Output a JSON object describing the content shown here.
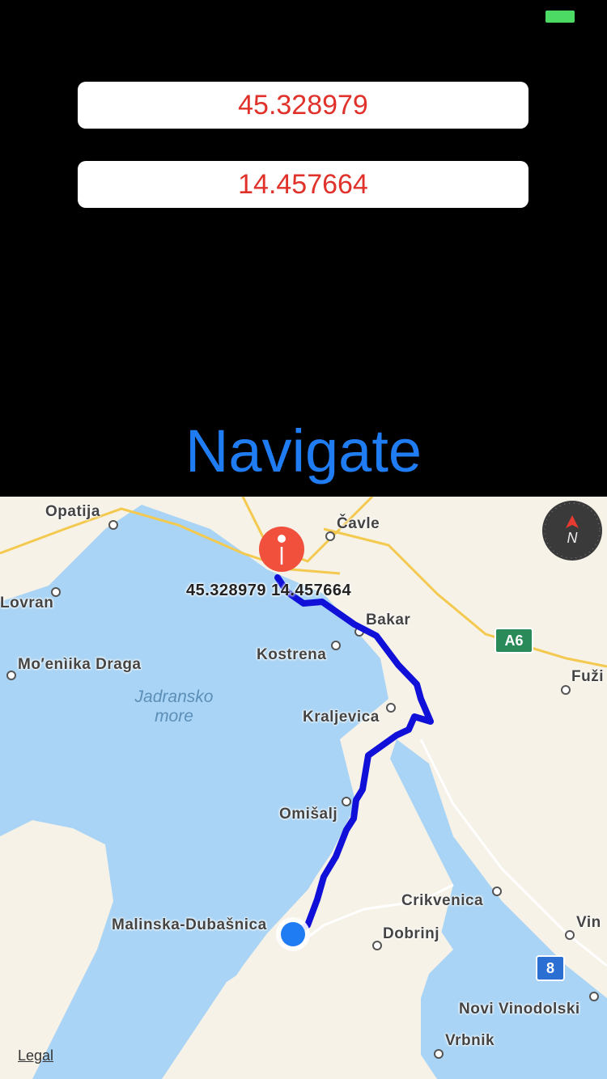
{
  "inputs": {
    "latitude": "45.328979",
    "longitude": "14.457664"
  },
  "navigate_label": "Navigate",
  "colors": {
    "field_text": "#e0322b",
    "button": "#1f7cf2",
    "route": "#1010d8",
    "sea": "#a9d4f5",
    "land": "#f6f2e7",
    "pin": "#f0503c",
    "user_dot": "#1f7cf2"
  },
  "map": {
    "pin_label": "45.328979 14.457664",
    "places": {
      "opatija": "Opatija",
      "cavle": "Čavle",
      "lovran": "Lovran",
      "bakar": "Bakar",
      "kostrena": "Kostrena",
      "moscenicka": "Mo′enìika Draga",
      "kraljevica": "Kraljevica",
      "fuzine": "Fuži",
      "omisalj": "Omišalj",
      "crikvenica": "Crikvenica",
      "malinska": "Malinska-Dubašnica",
      "dobrinj": "Dobrinj",
      "vinodol": "Vin",
      "novi": "Novi Vinodolski",
      "vrbnik": "Vrbnik"
    },
    "sea_label_line1": "Jadransko",
    "sea_label_line2": "more",
    "shield_a6": "A6",
    "shield_8": "8",
    "compass_label": "N",
    "legal": "Legal"
  }
}
